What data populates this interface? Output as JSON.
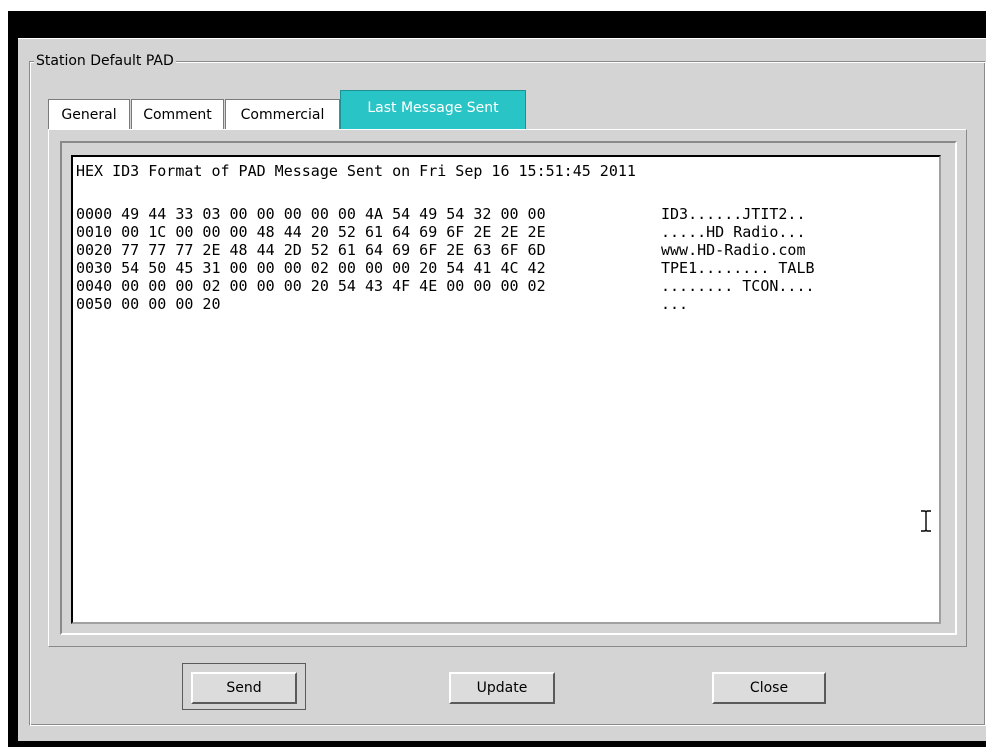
{
  "groupbox": {
    "title": "Station Default PAD"
  },
  "tabs": [
    {
      "label": "General",
      "active": false
    },
    {
      "label": "Comment",
      "active": false
    },
    {
      "label": "Commercial",
      "active": false
    },
    {
      "label": "Last Message Sent",
      "active": true
    }
  ],
  "message": {
    "header": "HEX ID3 Format of PAD Message Sent on Fri Sep 16 15:51:45 2011",
    "hex_lines": [
      "0000 49 44 33 03 00 00 00 00 00 4A 54 49 54 32 00 00",
      "0010 00 1C 00 00 00 48 44 20 52 61 64 69 6F 2E 2E 2E",
      "0020 77 77 77 2E 48 44 2D 52 61 64 69 6F 2E 63 6F 6D",
      "0030 54 50 45 31 00 00 00 02 00 00 00 20 54 41 4C 42",
      "0040 00 00 00 02 00 00 00 20 54 43 4F 4E 00 00 00 02",
      "0050 00 00 00 20"
    ],
    "ascii_lines": [
      "ID3......JTIT2..",
      ".....HD Radio...",
      "www.HD-Radio.com",
      "TPE1........ TALB",
      "........ TCON....",
      "..."
    ]
  },
  "buttons": {
    "send": "Send",
    "update": "Update",
    "close": "Close"
  },
  "colors": {
    "active_tab": "#29c4c6",
    "window_bg": "#d4d4d4",
    "frame": "#000000"
  },
  "cursor_icon": "ibeam-cursor-icon"
}
